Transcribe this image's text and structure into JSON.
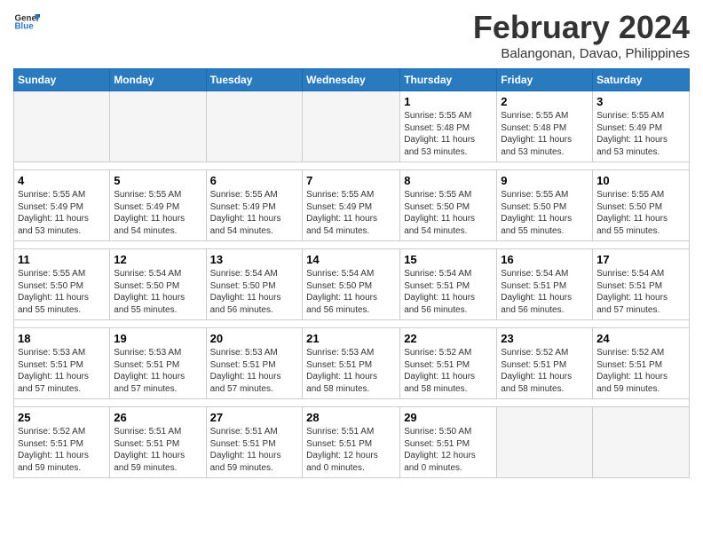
{
  "logo": {
    "line1": "General",
    "line2": "Blue"
  },
  "title": "February 2024",
  "subtitle": "Balangonan, Davao, Philippines",
  "weekdays": [
    "Sunday",
    "Monday",
    "Tuesday",
    "Wednesday",
    "Thursday",
    "Friday",
    "Saturday"
  ],
  "weeks": [
    [
      {
        "day": "",
        "info": ""
      },
      {
        "day": "",
        "info": ""
      },
      {
        "day": "",
        "info": ""
      },
      {
        "day": "",
        "info": ""
      },
      {
        "day": "1",
        "info": "Sunrise: 5:55 AM\nSunset: 5:48 PM\nDaylight: 11 hours\nand 53 minutes."
      },
      {
        "day": "2",
        "info": "Sunrise: 5:55 AM\nSunset: 5:48 PM\nDaylight: 11 hours\nand 53 minutes."
      },
      {
        "day": "3",
        "info": "Sunrise: 5:55 AM\nSunset: 5:49 PM\nDaylight: 11 hours\nand 53 minutes."
      }
    ],
    [
      {
        "day": "4",
        "info": "Sunrise: 5:55 AM\nSunset: 5:49 PM\nDaylight: 11 hours\nand 53 minutes."
      },
      {
        "day": "5",
        "info": "Sunrise: 5:55 AM\nSunset: 5:49 PM\nDaylight: 11 hours\nand 54 minutes."
      },
      {
        "day": "6",
        "info": "Sunrise: 5:55 AM\nSunset: 5:49 PM\nDaylight: 11 hours\nand 54 minutes."
      },
      {
        "day": "7",
        "info": "Sunrise: 5:55 AM\nSunset: 5:49 PM\nDaylight: 11 hours\nand 54 minutes."
      },
      {
        "day": "8",
        "info": "Sunrise: 5:55 AM\nSunset: 5:50 PM\nDaylight: 11 hours\nand 54 minutes."
      },
      {
        "day": "9",
        "info": "Sunrise: 5:55 AM\nSunset: 5:50 PM\nDaylight: 11 hours\nand 55 minutes."
      },
      {
        "day": "10",
        "info": "Sunrise: 5:55 AM\nSunset: 5:50 PM\nDaylight: 11 hours\nand 55 minutes."
      }
    ],
    [
      {
        "day": "11",
        "info": "Sunrise: 5:55 AM\nSunset: 5:50 PM\nDaylight: 11 hours\nand 55 minutes."
      },
      {
        "day": "12",
        "info": "Sunrise: 5:54 AM\nSunset: 5:50 PM\nDaylight: 11 hours\nand 55 minutes."
      },
      {
        "day": "13",
        "info": "Sunrise: 5:54 AM\nSunset: 5:50 PM\nDaylight: 11 hours\nand 56 minutes."
      },
      {
        "day": "14",
        "info": "Sunrise: 5:54 AM\nSunset: 5:50 PM\nDaylight: 11 hours\nand 56 minutes."
      },
      {
        "day": "15",
        "info": "Sunrise: 5:54 AM\nSunset: 5:51 PM\nDaylight: 11 hours\nand 56 minutes."
      },
      {
        "day": "16",
        "info": "Sunrise: 5:54 AM\nSunset: 5:51 PM\nDaylight: 11 hours\nand 56 minutes."
      },
      {
        "day": "17",
        "info": "Sunrise: 5:54 AM\nSunset: 5:51 PM\nDaylight: 11 hours\nand 57 minutes."
      }
    ],
    [
      {
        "day": "18",
        "info": "Sunrise: 5:53 AM\nSunset: 5:51 PM\nDaylight: 11 hours\nand 57 minutes."
      },
      {
        "day": "19",
        "info": "Sunrise: 5:53 AM\nSunset: 5:51 PM\nDaylight: 11 hours\nand 57 minutes."
      },
      {
        "day": "20",
        "info": "Sunrise: 5:53 AM\nSunset: 5:51 PM\nDaylight: 11 hours\nand 57 minutes."
      },
      {
        "day": "21",
        "info": "Sunrise: 5:53 AM\nSunset: 5:51 PM\nDaylight: 11 hours\nand 58 minutes."
      },
      {
        "day": "22",
        "info": "Sunrise: 5:52 AM\nSunset: 5:51 PM\nDaylight: 11 hours\nand 58 minutes."
      },
      {
        "day": "23",
        "info": "Sunrise: 5:52 AM\nSunset: 5:51 PM\nDaylight: 11 hours\nand 58 minutes."
      },
      {
        "day": "24",
        "info": "Sunrise: 5:52 AM\nSunset: 5:51 PM\nDaylight: 11 hours\nand 59 minutes."
      }
    ],
    [
      {
        "day": "25",
        "info": "Sunrise: 5:52 AM\nSunset: 5:51 PM\nDaylight: 11 hours\nand 59 minutes."
      },
      {
        "day": "26",
        "info": "Sunrise: 5:51 AM\nSunset: 5:51 PM\nDaylight: 11 hours\nand 59 minutes."
      },
      {
        "day": "27",
        "info": "Sunrise: 5:51 AM\nSunset: 5:51 PM\nDaylight: 11 hours\nand 59 minutes."
      },
      {
        "day": "28",
        "info": "Sunrise: 5:51 AM\nSunset: 5:51 PM\nDaylight: 12 hours\nand 0 minutes."
      },
      {
        "day": "29",
        "info": "Sunrise: 5:50 AM\nSunset: 5:51 PM\nDaylight: 12 hours\nand 0 minutes."
      },
      {
        "day": "",
        "info": ""
      },
      {
        "day": "",
        "info": ""
      }
    ]
  ]
}
